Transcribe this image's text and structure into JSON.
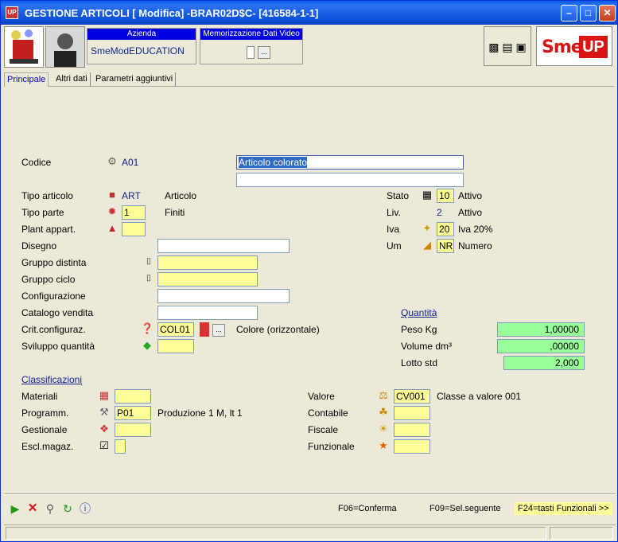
{
  "window": {
    "title": "GESTIONE ARTICOLI [ Modifica] -BRAR02D$C- [416584-1-1]",
    "app_badge": "UP"
  },
  "header": {
    "azienda_label": "Azienda",
    "azienda_value": "SmeModEDUCATION",
    "memo_label": "Memorizzazione Dati Video",
    "memo_button": "...",
    "logo_text": "Sme.",
    "logo_box": "UP"
  },
  "tabs": [
    "Principale",
    "Altri dati",
    "Parametri aggiuntivi"
  ],
  "form": {
    "codice": {
      "label": "Codice",
      "value": "A01",
      "description": "Articolo colorato",
      "description2": ""
    },
    "tipo_articolo": {
      "label": "Tipo articolo",
      "value": "ART",
      "desc": "Articolo"
    },
    "tipo_parte": {
      "label": "Tipo parte",
      "value": "1",
      "desc": "Finiti"
    },
    "plant": {
      "label": "Plant appart.",
      "value": ""
    },
    "disegno": {
      "label": "Disegno",
      "value": ""
    },
    "gruppo_distinta": {
      "label": "Gruppo distinta",
      "value": ""
    },
    "gruppo_ciclo": {
      "label": "Gruppo ciclo",
      "value": ""
    },
    "configurazione": {
      "label": "Configurazione",
      "value": ""
    },
    "catalogo": {
      "label": "Catalogo vendita",
      "value": ""
    },
    "crit_config": {
      "label": "Crit.configuraz.",
      "value": "COL01",
      "button": "...",
      "desc": "Colore (orizzontale)"
    },
    "sviluppo": {
      "label": "Sviluppo quantità",
      "value": ""
    },
    "stato": {
      "label": "Stato",
      "value": "10",
      "desc": "Attivo"
    },
    "liv": {
      "label": "Liv.",
      "value": "2",
      "desc": "Attivo"
    },
    "iva": {
      "label": "Iva",
      "value": "20",
      "desc": "Iva 20%"
    },
    "um": {
      "label": "Um",
      "value": "NR",
      "desc": "Numero"
    }
  },
  "quantita": {
    "title": "Quantità",
    "peso": {
      "label": "Peso Kg",
      "value": "1,00000"
    },
    "volume": {
      "label": "Volume dm³",
      "value": ",00000"
    },
    "lotto": {
      "label": "Lotto std",
      "value": "2,000"
    }
  },
  "classificazioni": {
    "title": "Classificazioni",
    "materiali": {
      "label": "Materiali",
      "value": ""
    },
    "programm": {
      "label": "Programm.",
      "value": "P01",
      "desc": "Produzione 1 M, lt 1"
    },
    "gestionale": {
      "label": "Gestionale",
      "value": ""
    },
    "escl": {
      "label": "Escl.magaz.",
      "value": ""
    },
    "valore": {
      "label": "Valore",
      "value": "CV001",
      "desc": "Classe a valore 001"
    },
    "contabile": {
      "label": "Contabile",
      "value": ""
    },
    "fiscale": {
      "label": "Fiscale",
      "value": ""
    },
    "funzionale": {
      "label": "Funzionale",
      "value": ""
    }
  },
  "footer": {
    "f06": "F06=Conferma",
    "f09": "F09=Sel.seguente",
    "f24": "F24=tasti Funzionali >>"
  },
  "colors": {
    "title_bar": "#0a4fd6",
    "input_yellow": "#ffff99",
    "input_green": "#99ff99",
    "link_blue": "#10208f",
    "logo_red": "#d81414"
  }
}
